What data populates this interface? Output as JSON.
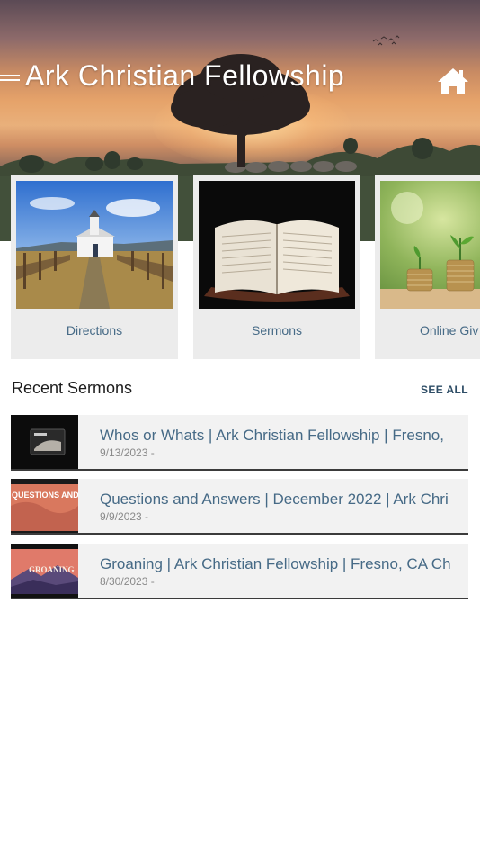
{
  "header": {
    "title": "Ark Christian Fellowship",
    "menu_icon": "hamburger-menu-icon",
    "home_icon": "home-icon"
  },
  "cards": [
    {
      "label": "Directions",
      "image": "country-church-photo"
    },
    {
      "label": "Sermons",
      "image": "open-bible-photo"
    },
    {
      "label": "Online Giv",
      "image": "coins-plants-photo"
    }
  ],
  "recent_sermons": {
    "title": "Recent Sermons",
    "see_all": "SEE ALL",
    "items": [
      {
        "title": "Whos or Whats | Ark Christian Fellowship | Fresno,",
        "date": "9/13/2023 -"
      },
      {
        "title": "Questions and Answers | December 2022 | Ark Chri",
        "date": "9/9/2023 -",
        "thumb_text": "QUESTIONS AND ANS"
      },
      {
        "title": "Groaning | Ark Christian Fellowship | Fresno, CA Ch",
        "date": "8/30/2023 -",
        "thumb_text": "GROANING"
      }
    ]
  },
  "colors": {
    "link_blue": "#466a86",
    "card_bg": "#ececec",
    "row_bg": "#f2f2f2"
  }
}
